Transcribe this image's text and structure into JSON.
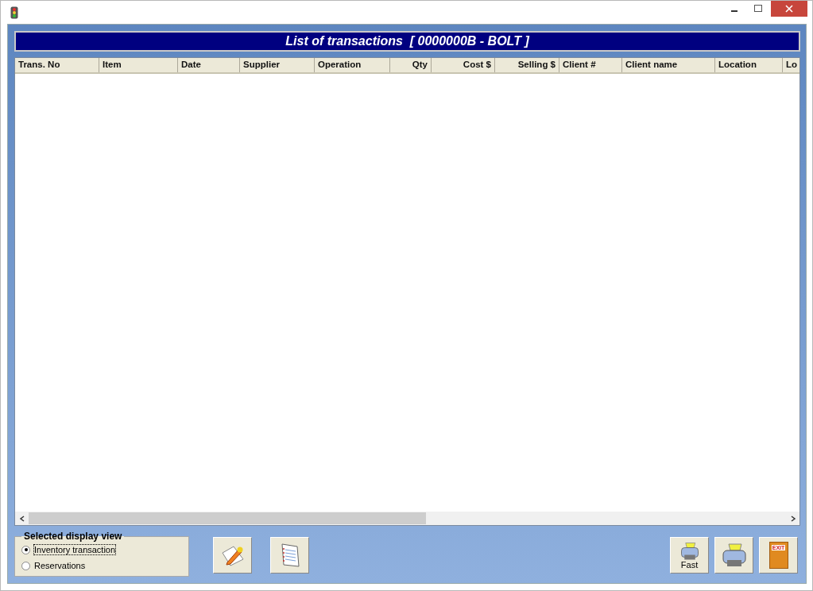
{
  "header": {
    "title": "List of transactions  [ 0000000B - BOLT ]"
  },
  "table": {
    "columns": [
      {
        "label": "Trans. No",
        "numeric": false
      },
      {
        "label": "Item",
        "numeric": false
      },
      {
        "label": "Date",
        "numeric": false
      },
      {
        "label": "Supplier",
        "numeric": false
      },
      {
        "label": "Operation",
        "numeric": false
      },
      {
        "label": "Qty",
        "numeric": true
      },
      {
        "label": "Cost $",
        "numeric": true
      },
      {
        "label": "Selling $",
        "numeric": true
      },
      {
        "label": "Client #",
        "numeric": false
      },
      {
        "label": "Client name",
        "numeric": false
      },
      {
        "label": "Location",
        "numeric": false
      },
      {
        "label": "Lo",
        "numeric": false
      }
    ]
  },
  "view_group": {
    "title": "Selected display view",
    "options": [
      {
        "label": "Inventory transaction",
        "selected": true
      },
      {
        "label": "Reservations",
        "selected": false
      }
    ]
  },
  "buttons": [
    {
      "kind": "edit"
    },
    {
      "kind": "notes"
    },
    {
      "kind": "print",
      "label": "Fast"
    },
    {
      "kind": "print"
    },
    {
      "kind": "exit",
      "label": "EXIT"
    }
  ]
}
